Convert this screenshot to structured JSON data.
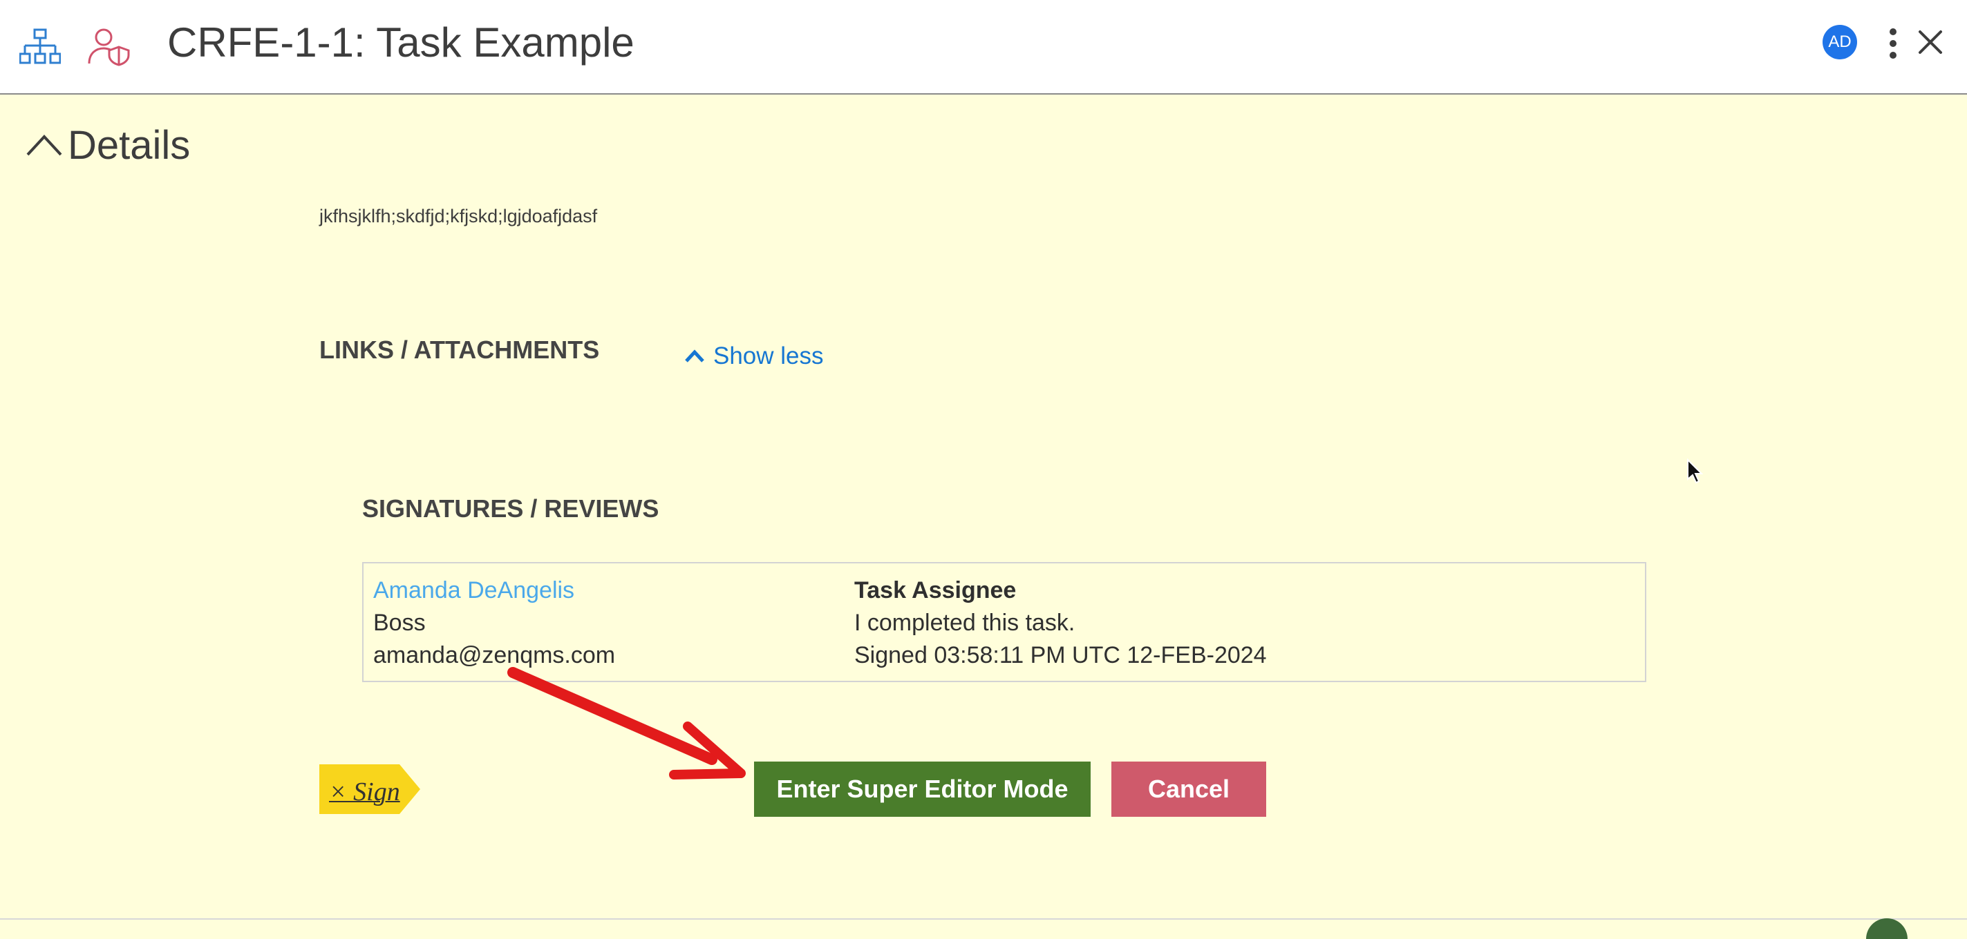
{
  "header": {
    "title": "CRFE-1-1: Task Example",
    "avatar_initials": "AD",
    "icons": [
      "hierarchy-icon",
      "user-shield-icon",
      "kebab-menu-icon",
      "close-icon"
    ]
  },
  "details": {
    "toggle_label": "Details",
    "description": "jkfhsjklfh;skdfjd;kfjskd;lgjdoafjdasf"
  },
  "links": {
    "heading": "LINKS / ATTACHMENTS",
    "show_less_label": "Show less"
  },
  "signatures": {
    "heading": "SIGNATURES / REVIEWS",
    "entries": [
      {
        "name": "Amanda DeAngelis",
        "title": "Boss",
        "email": "amanda@zenqms.com",
        "role": "Task Assignee",
        "comment": "I completed this task.",
        "signed": "Signed 03:58:11 PM UTC 12-FEB-2024"
      }
    ]
  },
  "actions": {
    "xsign_label": "× Sign",
    "super_editor_label": "Enter Super Editor Mode",
    "cancel_label": "Cancel"
  },
  "colors": {
    "background": "#fffedb",
    "primary_link": "#1676d2",
    "super_editor": "#4a7d2b",
    "cancel": "#cf5a6b",
    "xsign_tag": "#f8d51c",
    "arrow": "#e21b1b",
    "avatar": "#1f74e8"
  }
}
